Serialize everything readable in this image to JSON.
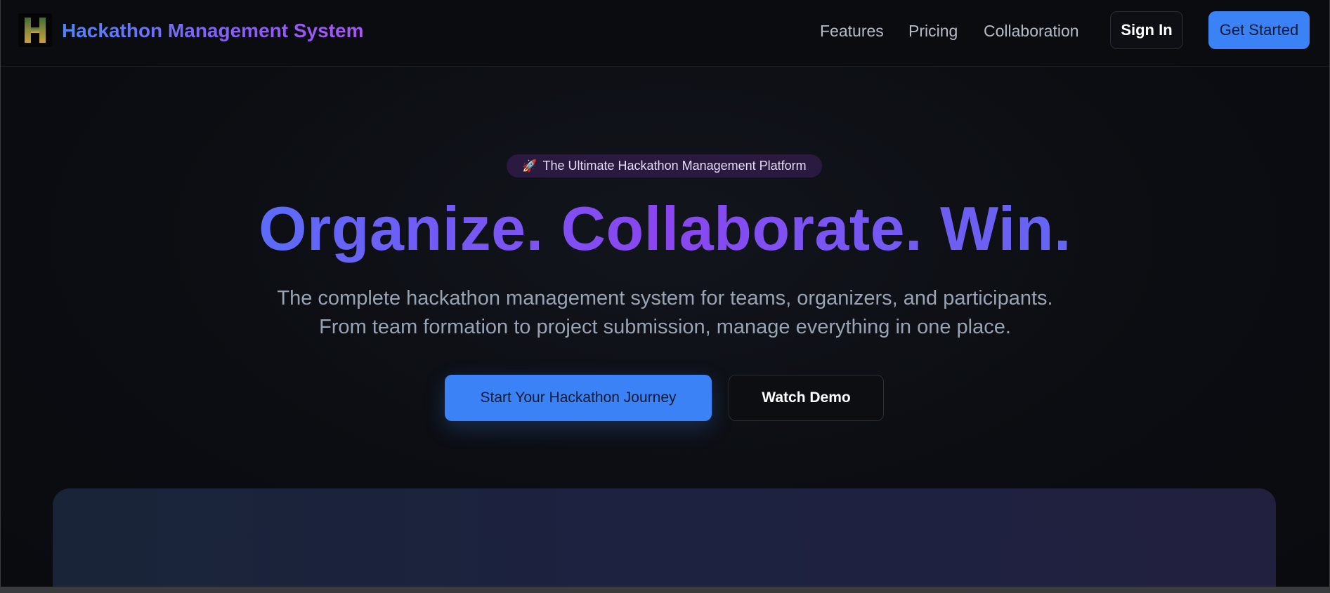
{
  "nav": {
    "logo_letter": "H",
    "brand": "Hackathon Management System",
    "links": [
      "Features",
      "Pricing",
      "Collaboration"
    ],
    "signin_label": "Sign In",
    "getstarted_label": "Get Started"
  },
  "hero": {
    "badge_icon": "🚀",
    "badge_text": "The Ultimate Hackathon Management Platform",
    "headline": "Organize. Collaborate. Win.",
    "subtitle_line1": "The complete hackathon management system for teams, organizers, and participants.",
    "subtitle_line2": "From team formation to project submission, manage everything in one place.",
    "primary_cta": "Start Your Hackathon Journey",
    "secondary_cta": "Watch Demo"
  },
  "colors": {
    "accent": "#3b82f6",
    "gradient_start": "#4f86f7",
    "gradient_end": "#a855f7",
    "background": "#0b0d12"
  }
}
